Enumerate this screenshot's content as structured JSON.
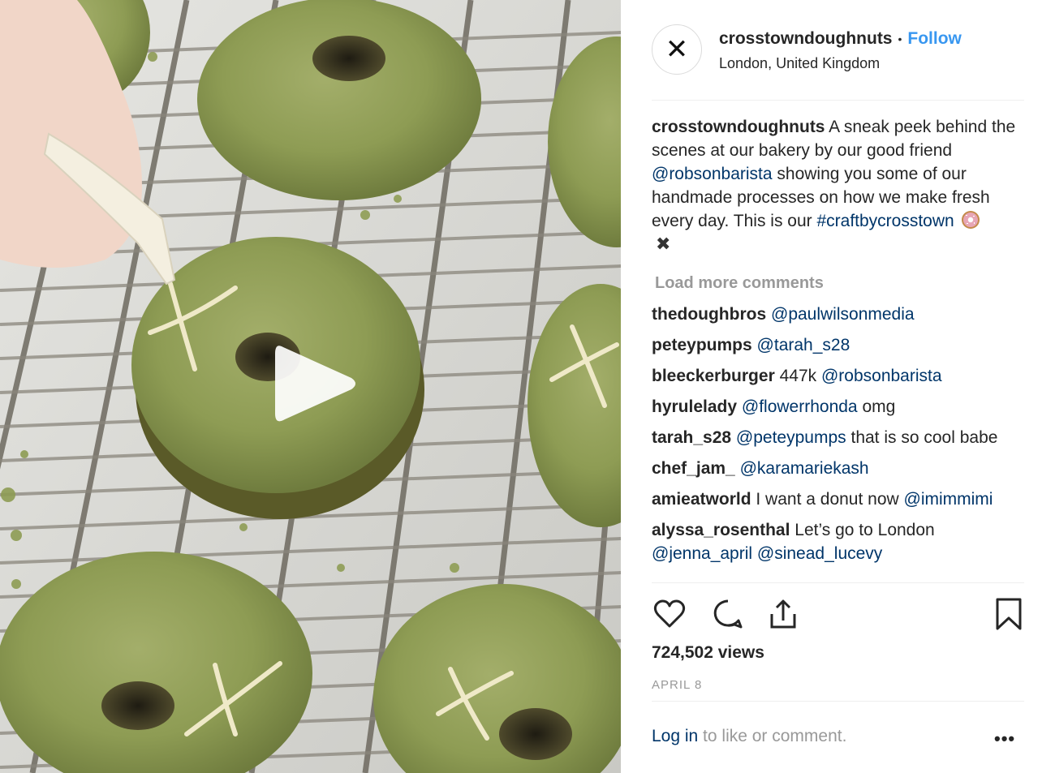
{
  "post": {
    "username": "crosstowndoughnuts",
    "separator": "•",
    "follow_label": "Follow",
    "location": "London, United Kingdom",
    "avatar_glyph": "✕"
  },
  "caption": {
    "username": "crosstowndoughnuts",
    "text_1": " A sneak peek behind the scenes at our bakery by our good friend ",
    "mention": "@robsonbarista",
    "text_2": " showing you some of our handmade processes on how we make fresh every day. This is our ",
    "hashtag": "#craftbycrosstown",
    "emoji_icon": "doughnut-icon",
    "x_glyph": "✖"
  },
  "load_more_label": "Load more comments",
  "comments": [
    {
      "username": "thedoughbros",
      "pre": "",
      "mention": "@paulwilsonmedia",
      "post": ""
    },
    {
      "username": "peteypumps",
      "pre": "",
      "mention": "@tarah_s28",
      "post": ""
    },
    {
      "username": "bleeckerburger",
      "pre": "447k ",
      "mention": "@robsonbarista",
      "post": ""
    },
    {
      "username": "hyrulelady",
      "pre": "",
      "mention": "@flowerrhonda",
      "post": " omg"
    },
    {
      "username": "tarah_s28",
      "pre": "",
      "mention": "@peteypumps",
      "post": " that is so cool babe"
    },
    {
      "username": "chef_jam_",
      "pre": "",
      "mention": "@karamariekash",
      "post": ""
    },
    {
      "username": "amieatworld",
      "pre": "I want a donut now ",
      "mention": "@imimmimi",
      "post": ""
    },
    {
      "username": "alyssa_rosenthal",
      "pre": "Let’s go to London ",
      "mention": "@jenna_april @sinead_lucevy",
      "post": ""
    }
  ],
  "actions": {
    "like_icon": "heart-icon",
    "comment_icon": "comment-bubble-icon",
    "share_icon": "share-icon",
    "save_icon": "bookmark-icon"
  },
  "views": "724,502 views",
  "date": "APRIL 8",
  "login": {
    "link_label": "Log in",
    "rest": " to like or comment."
  },
  "more_options": "•••",
  "colors": {
    "link_blue": "#003569",
    "follow_blue": "#3897f0",
    "muted_gray": "#999999",
    "glaze_green": "#8e9c54"
  }
}
